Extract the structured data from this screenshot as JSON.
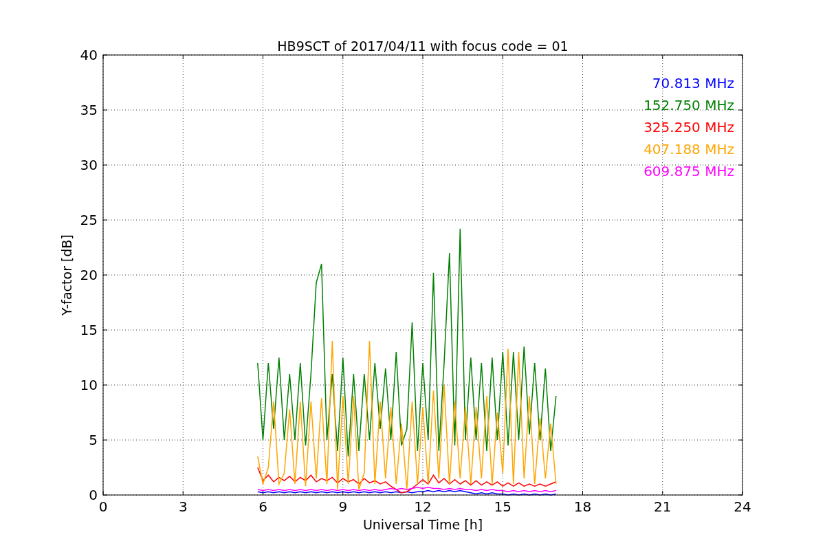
{
  "chart_data": {
    "type": "line",
    "title": "HB9SCT of 2017/04/11 with focus code = 01",
    "xlabel": "Universal Time [h]",
    "ylabel": "Y-factor [dB]",
    "x": [
      5.8,
      6.0,
      6.2,
      6.4,
      6.6,
      6.8,
      7.0,
      7.2,
      7.4,
      7.6,
      7.8,
      8.0,
      8.2,
      8.4,
      8.6,
      8.8,
      9.0,
      9.2,
      9.4,
      9.6,
      9.8,
      10.0,
      10.2,
      10.4,
      10.6,
      10.8,
      11.0,
      11.2,
      11.4,
      11.6,
      11.8,
      12.0,
      12.2,
      12.4,
      12.6,
      12.8,
      13.0,
      13.2,
      13.4,
      13.6,
      13.8,
      14.0,
      14.2,
      14.4,
      14.6,
      14.8,
      15.0,
      15.2,
      15.4,
      15.6,
      15.8,
      16.0,
      16.2,
      16.4,
      16.6,
      16.8,
      17.0
    ],
    "series": [
      {
        "name": "70.813 MHz",
        "color": "#0000ff",
        "values": [
          0.3,
          0.2,
          0.3,
          0.2,
          0.3,
          0.2,
          0.3,
          0.2,
          0.3,
          0.2,
          0.3,
          0.2,
          0.3,
          0.2,
          0.3,
          0.2,
          0.3,
          0.2,
          0.3,
          0.2,
          0.3,
          0.2,
          0.3,
          0.2,
          0.3,
          0.2,
          0.3,
          0.2,
          0.3,
          0.2,
          0.3,
          0.3,
          0.4,
          0.3,
          0.4,
          0.3,
          0.4,
          0.3,
          0.4,
          0.3,
          0.2,
          0.1,
          0.2,
          0.1,
          0.2,
          0.1,
          0.1,
          0.0,
          0.1,
          0.0,
          0.1,
          0.0,
          0.1,
          0.0,
          0.1,
          0.0,
          0.1
        ]
      },
      {
        "name": "152.750 MHz",
        "color": "#008000",
        "values": [
          12,
          5,
          12,
          6,
          12.5,
          5,
          11,
          5,
          12,
          4.5,
          11,
          19.3,
          21,
          5,
          11,
          4,
          12.5,
          3.5,
          11,
          4,
          11,
          5,
          12,
          6,
          11.5,
          5,
          13,
          4.5,
          6,
          15.7,
          4,
          12,
          5,
          20.2,
          4,
          12,
          22,
          4.5,
          24.2,
          5,
          12.5,
          5,
          12,
          4,
          12.5,
          5,
          13,
          4.5,
          13,
          5,
          13.5,
          5.5,
          12,
          5,
          11.5,
          4,
          9
        ]
      },
      {
        "name": "325.250 MHz",
        "color": "#ff0000",
        "values": [
          2.5,
          1.3,
          1.8,
          1.2,
          1.6,
          1.3,
          1.7,
          1.2,
          1.6,
          1.3,
          1.8,
          1.2,
          1.5,
          1.3,
          1.6,
          1.1,
          1.5,
          1.2,
          1.4,
          1.0,
          1.5,
          1.1,
          1.3,
          1.0,
          1.2,
          0.8,
          0.5,
          0.2,
          0.3,
          0.6,
          1.0,
          1.4,
          1.0,
          1.8,
          1.1,
          1.5,
          1.0,
          1.4,
          1.0,
          1.3,
          0.9,
          1.3,
          0.9,
          1.2,
          0.9,
          1.2,
          0.8,
          1.1,
          0.8,
          1.1,
          0.8,
          1.0,
          0.8,
          1.0,
          0.8,
          1.0,
          1.2
        ]
      },
      {
        "name": "407.188 MHz",
        "color": "#ffa500",
        "values": [
          3.5,
          1,
          2.5,
          8.5,
          1,
          2,
          7.8,
          1,
          8.5,
          0.8,
          8.5,
          1.5,
          8.8,
          1,
          14,
          0.5,
          9,
          1,
          9,
          0.5,
          2,
          14,
          1,
          8.5,
          1.5,
          8,
          1,
          6.5,
          0.5,
          8.5,
          1,
          8,
          1,
          9.5,
          1.5,
          10,
          1,
          8.5,
          1.5,
          8,
          1,
          8,
          1.5,
          9,
          1,
          7.5,
          2,
          13.3,
          1,
          13,
          1.5,
          9,
          1,
          7,
          1.5,
          6.5,
          1
        ]
      },
      {
        "name": "609.875 MHz",
        "color": "#ff00ff",
        "values": [
          0.5,
          0.4,
          0.5,
          0.4,
          0.5,
          0.4,
          0.5,
          0.4,
          0.5,
          0.4,
          0.5,
          0.4,
          0.5,
          0.4,
          0.5,
          0.4,
          0.5,
          0.4,
          0.5,
          0.4,
          0.5,
          0.4,
          0.5,
          0.4,
          0.5,
          0.6,
          0.5,
          0.6,
          0.5,
          0.6,
          0.7,
          0.6,
          0.7,
          0.6,
          0.6,
          0.5,
          0.6,
          0.5,
          0.6,
          0.5,
          0.5,
          0.4,
          0.5,
          0.4,
          0.5,
          0.4,
          0.4,
          0.3,
          0.4,
          0.3,
          0.4,
          0.3,
          0.4,
          0.3,
          0.4,
          0.3,
          0.4
        ]
      }
    ],
    "xlim": [
      0,
      24
    ],
    "ylim": [
      0,
      40
    ],
    "grid": true,
    "xticks": [
      0,
      3,
      6,
      9,
      12,
      15,
      18,
      21,
      24
    ],
    "yticks": [
      0,
      5,
      10,
      15,
      20,
      25,
      30,
      35,
      40
    ]
  }
}
